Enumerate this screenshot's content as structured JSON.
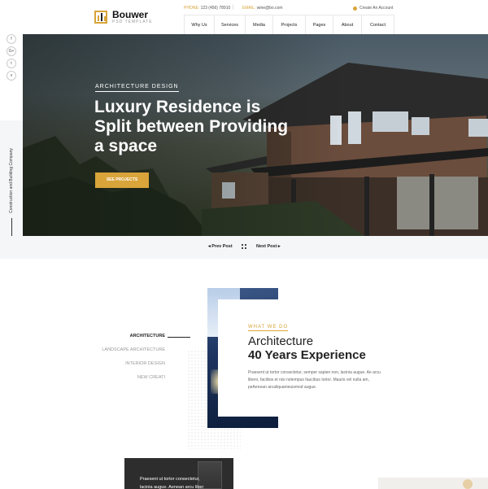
{
  "brand": {
    "name": "Bouwer",
    "tagline": "PSD TEMPLATE"
  },
  "topbar": {
    "phone_label": "PHONE:",
    "phone": "123 (456) 78910",
    "separator": "|",
    "email_label": "EMAIL:",
    "email": "wine@bo.com",
    "account": "Create An Account"
  },
  "nav": [
    "Why Us",
    "Services",
    "Media",
    "Projects",
    "Pages",
    "About",
    "Contact"
  ],
  "social": [
    "f",
    "G+",
    "t",
    "v"
  ],
  "vertical_text": "Construction and Building Company",
  "hero": {
    "kicker": "ARCHITECTURE DESIGN",
    "title": "Luxury Residence is Split between Providing a space",
    "button": "SEE PROJECTS"
  },
  "pager": {
    "prev": "Prev Post",
    "next": "Next Post"
  },
  "services": [
    "ARCHITECTURE",
    "LANDSCAPE ARCHITECTURE",
    "INTERIOR DESIGN",
    "NEW CREATI"
  ],
  "about": {
    "kicker": "WHAT WE DO",
    "title_line1": "Architecture",
    "title_line2": "40 Years Experience",
    "text": "Praesent ut tortor consectetur, semper sapien non, lacinia augue. Ae arcu libero, facilisis et nisi notempus faucibus tortor. Mauris vel nulla am, peAenean arcaliquameuismod augue."
  },
  "teaser": {
    "text": "Praesent ut tortor consectetur, lacinia augue. Aenean arcu liber"
  },
  "colors": {
    "accent": "#d9a43a",
    "dark": "#222222",
    "light_bg": "#f4f6f8"
  }
}
